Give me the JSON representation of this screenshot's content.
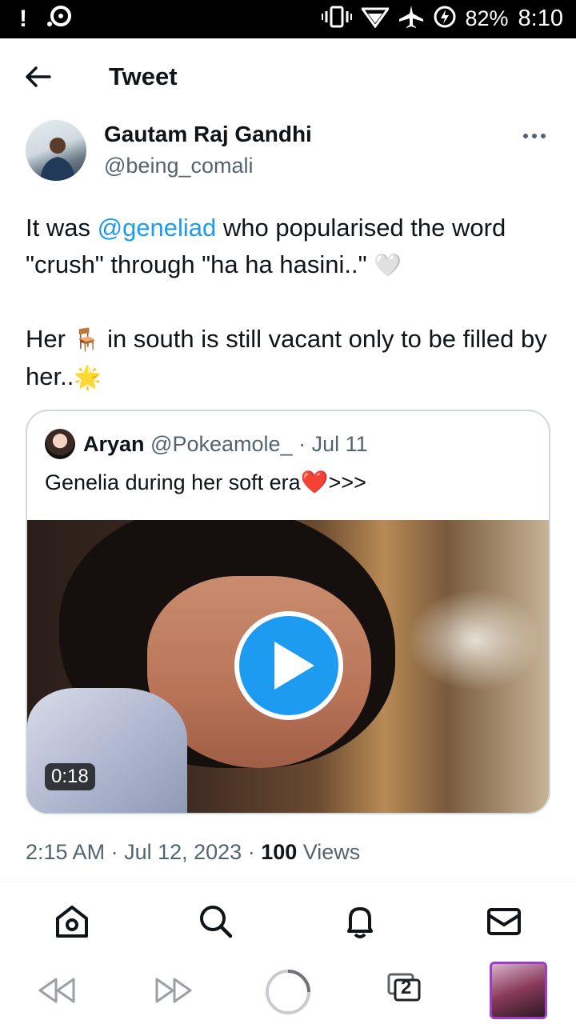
{
  "status_bar": {
    "battery": "82%",
    "time": "8:10",
    "icons": [
      "alert-icon",
      "media-icon",
      "vibrate-icon",
      "wifi-icon",
      "airplane-icon",
      "battery-charging-icon"
    ]
  },
  "header": {
    "title": "Tweet"
  },
  "author": {
    "name": "Gautam Raj Gandhi",
    "handle": "@being_comali"
  },
  "tweet": {
    "p1_before": "It was ",
    "p1_mention": "@geneliad",
    "p1_after": " who popularised the word \"crush\" through \"ha ha hasini..\" ",
    "p1_emoji": "🤍",
    "p2_before": "Her ",
    "p2_emoji1": "🪑",
    "p2_after": " in south is still vacant only to be filled by her..",
    "p2_emoji2": "🌟"
  },
  "quote": {
    "name": "Aryan",
    "handle": "@Pokeamole_",
    "sep": " · ",
    "date": "Jul 11",
    "text": "Genelia during her soft era",
    "emoji": "❤️",
    "suffix": ">>>",
    "duration": "0:18"
  },
  "meta": {
    "time": "2:15 AM",
    "sep": " · ",
    "date": "Jul 12, 2023",
    "views_count": "100",
    "views_label": "Views"
  },
  "bottom_nav": [
    "home-icon",
    "search-icon",
    "notifications-icon",
    "messages-icon"
  ],
  "system_bar": {
    "tab_count": "2"
  },
  "colors": {
    "accent": "#1d9bf0",
    "text": "#0f1419",
    "secondary": "#536471",
    "border": "#cfd9de"
  }
}
